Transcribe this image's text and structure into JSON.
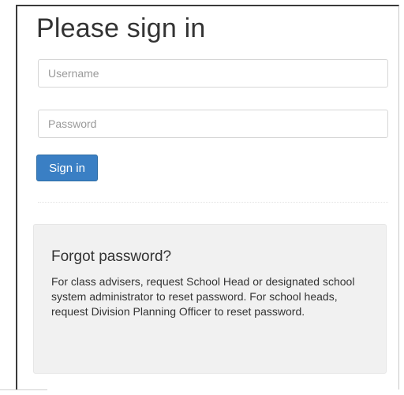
{
  "login": {
    "title": "Please sign in",
    "username_placeholder": "Username",
    "password_placeholder": "Password",
    "signin_label": "Sign in"
  },
  "forgot": {
    "heading": "Forgot password?",
    "body": "For class advisers, request School Head or designated school system administrator to reset password. For school heads, request Division Planning Officer to reset password."
  },
  "colors": {
    "primary_button": "#3a7fc4",
    "well_background": "#f1f1f1",
    "text": "#333333"
  }
}
